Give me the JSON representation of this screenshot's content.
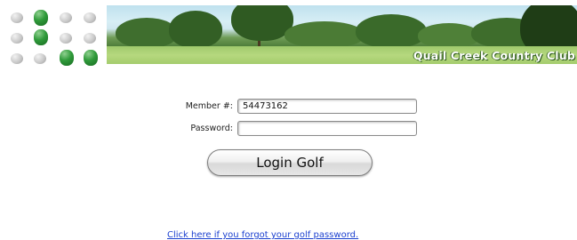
{
  "banner": {
    "club_name": "Quail Creek Country Club"
  },
  "login_form": {
    "member_label": "Member #:",
    "member_value": "54473162",
    "password_label": "Password:",
    "password_value": "",
    "login_button": "Login Golf"
  },
  "forgot_link": "Click here if you forgot your golf password.",
  "colors": {
    "accent_green": "#2f9a3a",
    "link_blue": "#1a3fcf"
  }
}
